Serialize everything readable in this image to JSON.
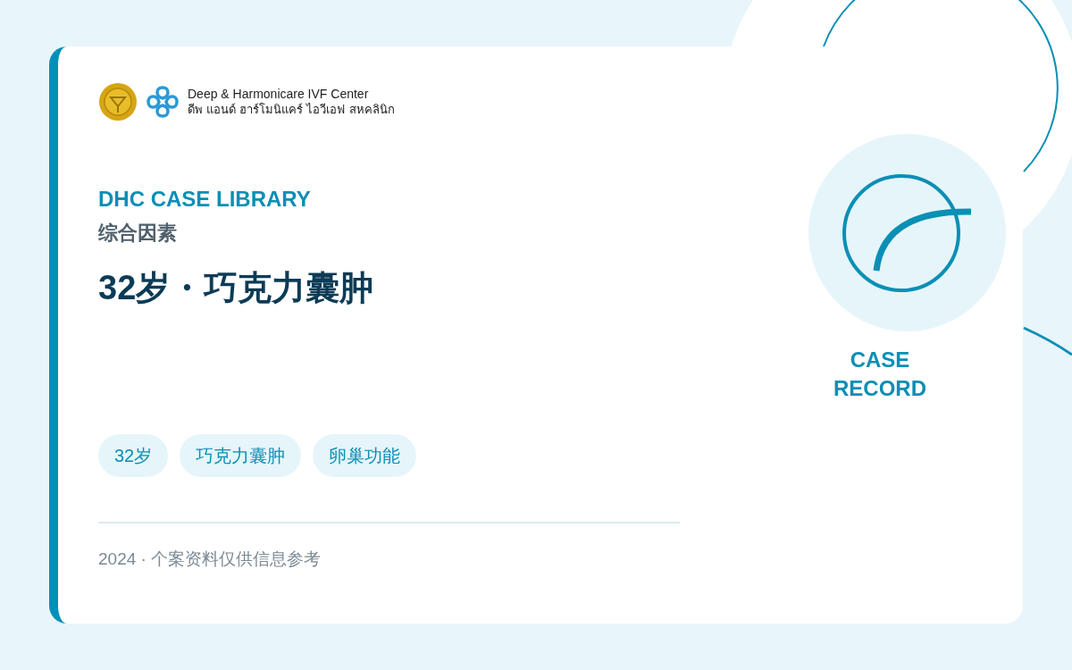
{
  "logo": {
    "name_en": "Deep & Harmonicare IVF Center",
    "name_th": "ดีพ แอนด์ ฮาร์โมนิแคร์ ไอวีเอฟ สหคลินิก"
  },
  "eyebrow": "DHC CASE LIBRARY",
  "category": "综合因素",
  "title": "32岁・巧克力囊肿",
  "tags": [
    "32岁",
    "巧克力囊肿",
    "卵巢功能"
  ],
  "footer": "2024 · 个案资料仅供信息参考",
  "badge_label": "CASE RECORD"
}
